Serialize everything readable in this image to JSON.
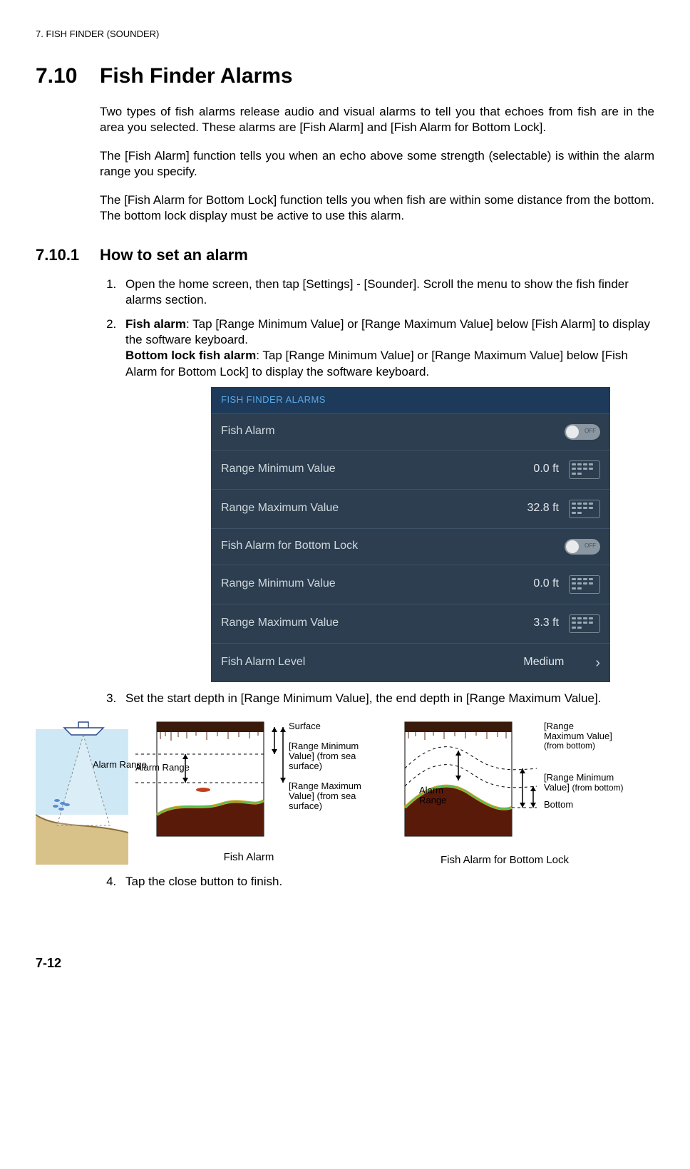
{
  "header": "7.  FISH FINDER (SOUNDER)",
  "section": {
    "num": "7.10",
    "title": "Fish Finder Alarms"
  },
  "intro1": "Two types of fish alarms release audio and visual alarms to tell you that echoes from fish are in the area you selected. These alarms are [Fish Alarm] and [Fish Alarm for Bottom Lock].",
  "intro2": "The [Fish Alarm] function tells you when an echo above some strength (selectable) is within the alarm range you specify.",
  "intro3": "The [Fish Alarm for Bottom Lock] function tells you when fish are within some distance from the bottom. The bottom lock display must be active to use this alarm.",
  "subsection": {
    "num": "7.10.1",
    "title": "How to set an alarm"
  },
  "step1": "Open the home screen, then tap [Settings] - [Sounder]. Scroll the menu to show the fish finder alarms section.",
  "step2a_label": "Fish alarm",
  "step2a": ": Tap [Range Minimum Value] or [Range Maximum Value] below [Fish Alarm] to display the software keyboard.",
  "step2b_label": "Bottom lock fish alarm",
  "step2b": ": Tap [Range Minimum Value] or [Range Maximum Value] below [Fish Alarm for Bottom Lock] to display the software keyboard.",
  "step3": "Set the start depth in [Range Minimum Value], the end depth in [Range Maximum Value].",
  "step4": "Tap the close button to finish.",
  "ui": {
    "header": "FISH FINDER ALARMS",
    "rows": [
      {
        "label": "Fish Alarm",
        "toggle": "OFF"
      },
      {
        "label": "Range Minimum Value",
        "value": "0.0 ft",
        "keypad": true
      },
      {
        "label": "Range Maximum Value",
        "value": "32.8 ft",
        "keypad": true
      },
      {
        "label": "Fish Alarm for Bottom Lock",
        "toggle": "OFF"
      },
      {
        "label": "Range Minimum Value",
        "value": "0.0 ft",
        "keypad": true
      },
      {
        "label": "Range Maximum Value",
        "value": "3.3 ft",
        "keypad": true
      },
      {
        "label": "Fish Alarm Level",
        "value": "Medium",
        "chevron": true
      }
    ]
  },
  "diag": {
    "surface": "Surface",
    "range_min_sea": "[Range Minimum Value] (from sea surface)",
    "range_max_sea": "[Range Maximum Value] (from sea surface)",
    "alarm_range": "Alarm Range",
    "fish_alarm": "Fish Alarm",
    "range_max_bottom": "[Range Maximum Value] (from bottom)",
    "range_min_bottom": "[Range Minimum Value] (from bottom)",
    "bottom": "Bottom",
    "fish_alarm_bl": "Fish Alarm for Bottom Lock"
  },
  "page_num": "7-12"
}
